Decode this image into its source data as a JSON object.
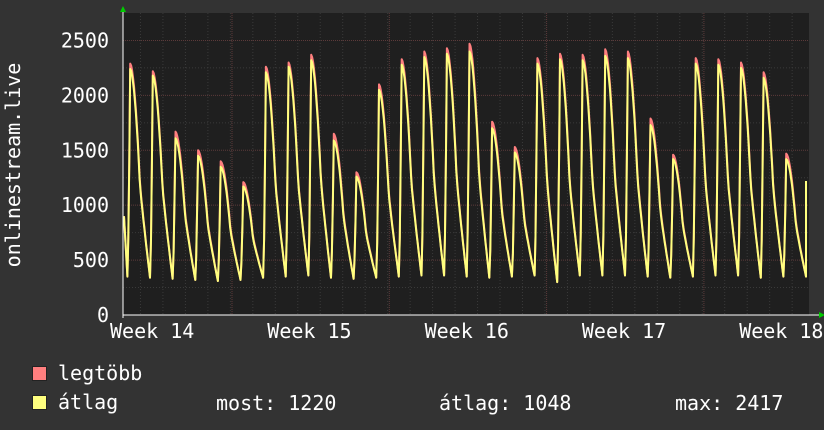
{
  "chart_data": {
    "type": "line",
    "ylabel": "onlinestream.live",
    "ylim": [
      0,
      2500
    ],
    "yticks": [
      0,
      500,
      1000,
      1500,
      2000,
      2500
    ],
    "xticks": [
      "Week 14",
      "Week 15",
      "Week 16",
      "Week 17",
      "Week 18"
    ],
    "grid": true,
    "series": [
      {
        "name": "legtöbb",
        "color": "#ff7f7f",
        "values": [
          2290,
          2220,
          1670,
          1500,
          1400,
          1210,
          2260,
          2300,
          2370,
          1650,
          1300,
          2100,
          2330,
          2400,
          2430,
          2470,
          1760,
          1530,
          2340,
          2380,
          2370,
          2420,
          2400,
          1790,
          1460,
          2340,
          2330,
          2300,
          2210,
          1470
        ]
      },
      {
        "name": "átlag",
        "color": "#ffff7f",
        "values": [
          2240,
          2180,
          1610,
          1450,
          1350,
          1170,
          2210,
          2260,
          2320,
          1590,
          1260,
          2050,
          2280,
          2350,
          2380,
          2400,
          1700,
          1480,
          2290,
          2330,
          2320,
          2360,
          2340,
          1730,
          1420,
          2290,
          2280,
          2250,
          2160,
          1420
        ]
      }
    ],
    "minimum_values": [
      350,
      340,
      330,
      320,
      310,
      320,
      340,
      350,
      360,
      340,
      330,
      340,
      350,
      360,
      360,
      350,
      340,
      350,
      360,
      300,
      360,
      360,
      360,
      350,
      340,
      350,
      360,
      360,
      340,
      350
    ],
    "last_value": 1220
  },
  "legend": {
    "max_label": "legtöbb",
    "avg_label": "átlag",
    "max_color": "#ff7f7f",
    "avg_color": "#ffff7f",
    "stat_now": "most: 1220",
    "stat_avg": "átlag: 1048",
    "stat_max": "max: 2417"
  }
}
